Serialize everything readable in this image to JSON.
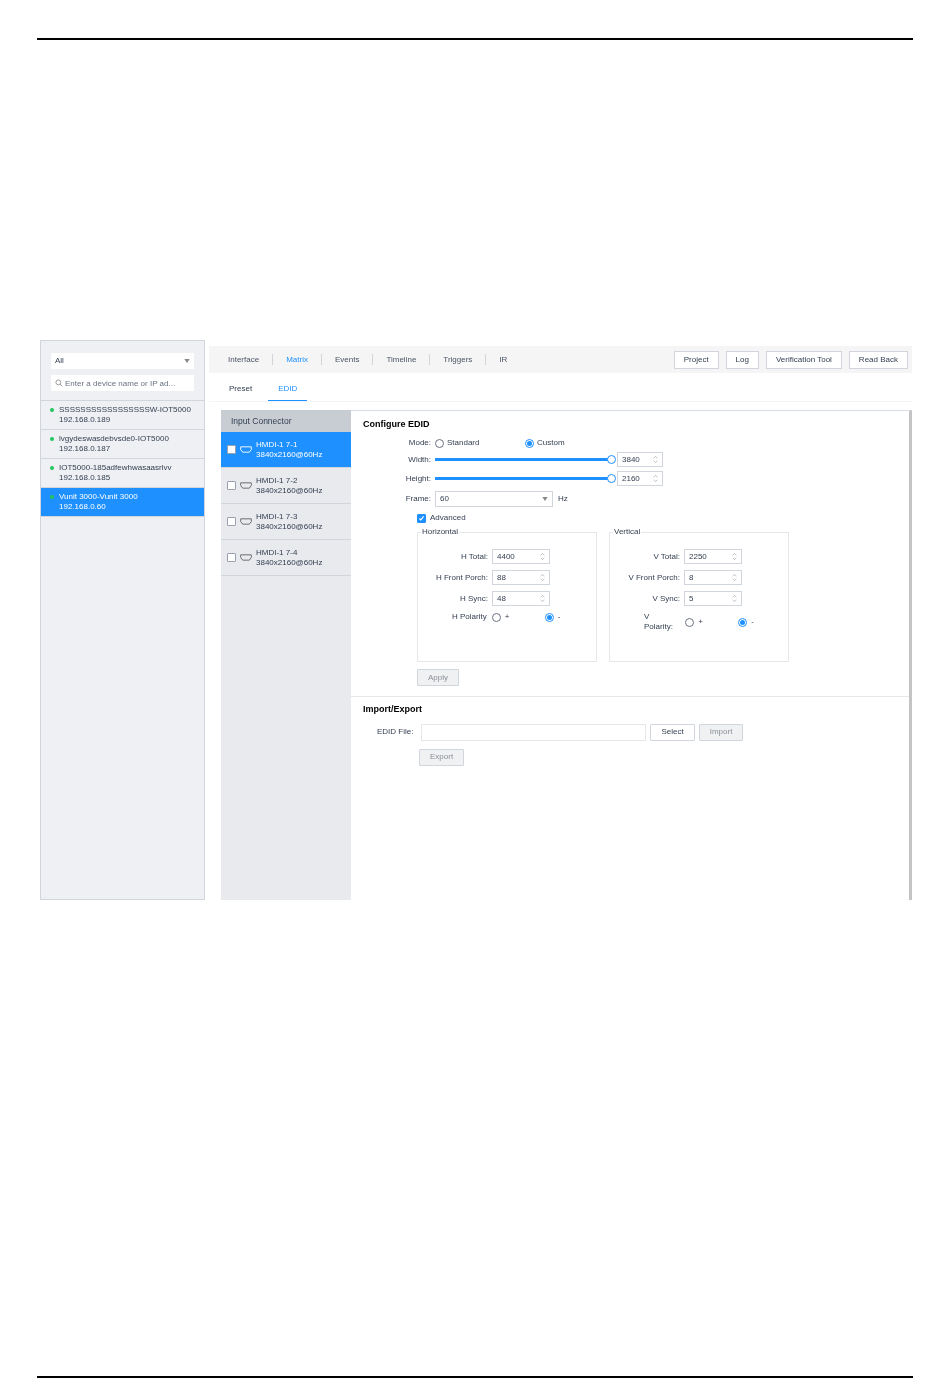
{
  "device_filter": {
    "value": "All"
  },
  "device_search": {
    "placeholder": "Enter a device name or IP ad..."
  },
  "devices": [
    {
      "name": "SSSSSSSSSSSSSSSSSW-IOT5000",
      "ip": "192.168.0.189",
      "online": true,
      "selected": false
    },
    {
      "name": "lvgydeswasdebvsde0-IOT5000",
      "ip": "192.168.0.187",
      "online": true,
      "selected": false
    },
    {
      "name": "IOT5000-185adfewhwasaasrlvv",
      "ip": "192.168.0.185",
      "online": true,
      "selected": false
    },
    {
      "name": "Vunit 3000-Vunit 3000",
      "ip": "192.168.0.60",
      "online": true,
      "selected": true
    }
  ],
  "tabs": [
    {
      "label": "Interface",
      "selected": false
    },
    {
      "label": "Matrix",
      "selected": true
    },
    {
      "label": "Events",
      "selected": false
    },
    {
      "label": "Timeline",
      "selected": false
    },
    {
      "label": "Triggers",
      "selected": false
    },
    {
      "label": "IR",
      "selected": false
    }
  ],
  "toolbar_buttons": [
    "Project",
    "Log",
    "Verification Tool",
    "Read Back"
  ],
  "subtabs": [
    {
      "label": "Preset",
      "selected": false
    },
    {
      "label": "EDID",
      "selected": true
    }
  ],
  "connectors": {
    "header": "Input Connector",
    "items": [
      {
        "name": "HMDI-1 7-1",
        "resolution": "3840x2160@60Hz",
        "selected": true,
        "checked": false
      },
      {
        "name": "HMDI-1 7-2",
        "resolution": "3840x2160@60Hz",
        "selected": false,
        "checked": false
      },
      {
        "name": "HMDI-1 7-3",
        "resolution": "3840x2160@60Hz",
        "selected": false,
        "checked": false
      },
      {
        "name": "HMDI-1 7-4",
        "resolution": "3840x2160@60Hz",
        "selected": false,
        "checked": false
      }
    ]
  },
  "configure": {
    "title": "Configure EDID",
    "mode": {
      "label": "Mode:",
      "options": [
        {
          "label": "Standard",
          "selected": false
        },
        {
          "label": "Custom",
          "selected": true
        }
      ]
    },
    "sliders": [
      {
        "label": "Width:",
        "level": 1,
        "value": "3840"
      },
      {
        "label": "Height:",
        "level": 1,
        "value": "2160"
      }
    ],
    "frame": {
      "label": "Frame:",
      "value": "60",
      "unit": "Hz"
    },
    "advanced": {
      "label": "Advanced",
      "checked": true
    },
    "groups": [
      {
        "title": "Horizontal",
        "fields": [
          {
            "label": "H Total:",
            "value": "4400"
          },
          {
            "label": "H Front Porch:",
            "value": "88"
          },
          {
            "label": "H Sync:",
            "value": "48"
          }
        ],
        "polarity": {
          "label": "H Polarity",
          "options": [
            {
              "label": "+",
              "selected": false
            },
            {
              "label": "-",
              "selected": true
            }
          ]
        }
      },
      {
        "title": "Vertical",
        "fields": [
          {
            "label": "V Total:",
            "value": "2250"
          },
          {
            "label": "V Front Porch:",
            "value": "8"
          },
          {
            "label": "V Sync:",
            "value": "5"
          }
        ],
        "polarity": {
          "label": "V Polarity:",
          "options": [
            {
              "label": "+",
              "selected": false
            },
            {
              "label": "-",
              "selected": true
            }
          ]
        }
      }
    ],
    "apply": {
      "label": "Apply",
      "disabled": true
    }
  },
  "import_export": {
    "title": "Import/Export",
    "file_label": "EDID File:",
    "select": {
      "label": "Select",
      "disabled": false
    },
    "import": {
      "label": "Import",
      "disabled": true
    },
    "export": {
      "label": "Export",
      "disabled": true
    }
  }
}
